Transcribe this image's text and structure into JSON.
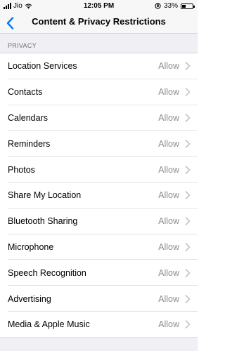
{
  "status_bar": {
    "carrier": "Jio",
    "time": "12:05 PM",
    "battery_percent": "33%",
    "battery_level": 0.33
  },
  "nav": {
    "title": "Content & Privacy Restrictions"
  },
  "section": {
    "header": "PRIVACY"
  },
  "rows": [
    {
      "label": "Location Services",
      "value": "Allow"
    },
    {
      "label": "Contacts",
      "value": "Allow"
    },
    {
      "label": "Calendars",
      "value": "Allow"
    },
    {
      "label": "Reminders",
      "value": "Allow"
    },
    {
      "label": "Photos",
      "value": "Allow"
    },
    {
      "label": "Share My Location",
      "value": "Allow"
    },
    {
      "label": "Bluetooth Sharing",
      "value": "Allow"
    },
    {
      "label": "Microphone",
      "value": "Allow"
    },
    {
      "label": "Speech Recognition",
      "value": "Allow"
    },
    {
      "label": "Advertising",
      "value": "Allow"
    },
    {
      "label": "Media & Apple Music",
      "value": "Allow"
    }
  ],
  "colors": {
    "accent": "#007aff",
    "secondary_text": "#8e8e93",
    "grouped_background": "#efeff4"
  }
}
